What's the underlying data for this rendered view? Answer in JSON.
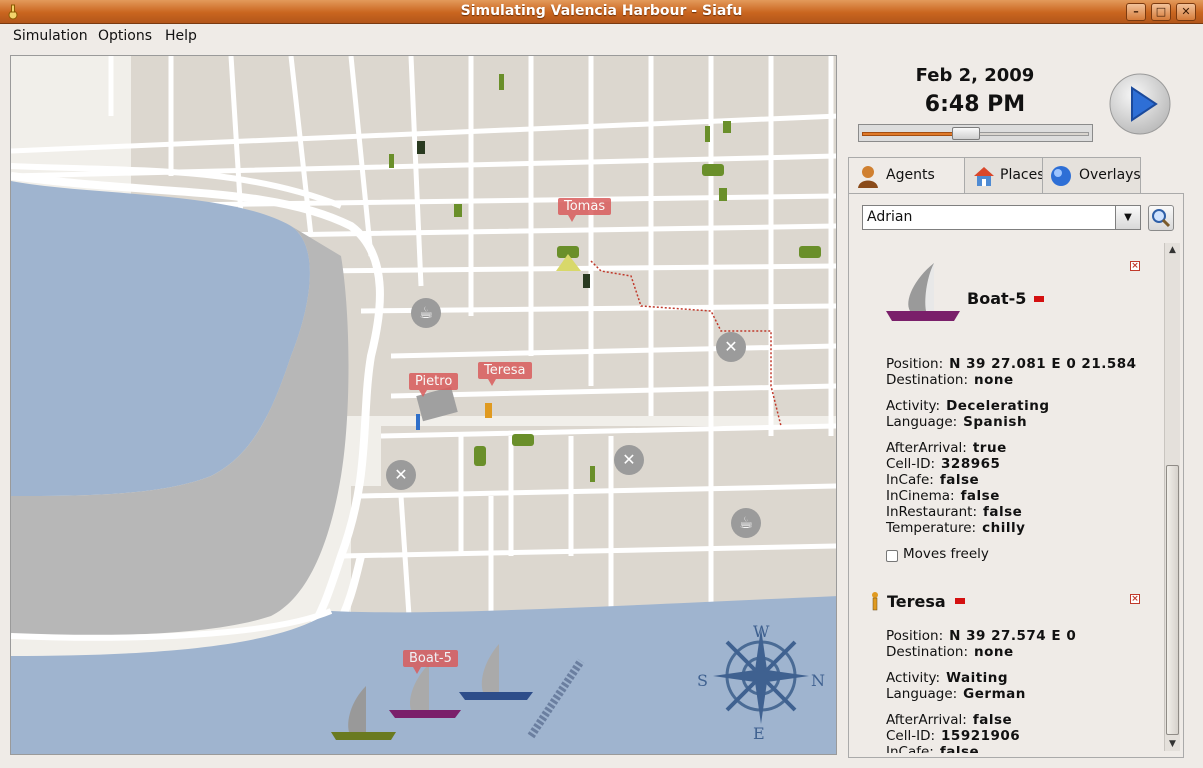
{
  "window": {
    "title": "Simulating Valencia Harbour - Siafu"
  },
  "menu": {
    "simulation": "Simulation",
    "options": "Options",
    "help": "Help"
  },
  "clock": {
    "date": "Feb 2, 2009",
    "time": "6:48 PM",
    "progress": 0.46
  },
  "tabs": {
    "agents": "Agents",
    "places": "Places",
    "overlays": "Overlays",
    "active": "Agents"
  },
  "search": {
    "value": "Adrian"
  },
  "map": {
    "labels": {
      "tomas": "Tomas",
      "pietro": "Pietro",
      "teresa": "Teresa",
      "boat5": "Boat-5"
    },
    "compass": {
      "north": "N",
      "south": "S",
      "east": "E",
      "west": "W"
    },
    "water_color": "#9fb4cf",
    "land_color": "#f1efea"
  },
  "agents": [
    {
      "name": "Boat-5",
      "position_label": "Position:",
      "position": "N 39 27.081 E 0 21.584",
      "destination_label": "Destination:",
      "destination": "none",
      "activity_label": "Activity:",
      "activity": "Decelerating",
      "language_label": "Language:",
      "language": "Spanish",
      "afterarrival_label": "AfterArrival:",
      "afterarrival": "true",
      "cellid_label": "Cell-ID:",
      "cellid": "328965",
      "incafe_label": "InCafe:",
      "incafe": "false",
      "incinema_label": "InCinema:",
      "incinema": "false",
      "inrestaurant_label": "InRestaurant:",
      "inrestaurant": "false",
      "temperature_label": "Temperature:",
      "temperature": "chilly",
      "moves_freely": "Moves freely"
    },
    {
      "name": "Teresa",
      "position_label": "Position:",
      "position": "N 39 27.574 E 0",
      "destination_label": "Destination:",
      "destination": "none",
      "activity_label": "Activity:",
      "activity": "Waiting",
      "language_label": "Language:",
      "language": "German",
      "afterarrival_label": "AfterArrival:",
      "afterarrival": "false",
      "cellid_label": "Cell-ID:",
      "cellid": "15921906",
      "incafe_label": "InCafe:",
      "incafe": "false"
    }
  ]
}
